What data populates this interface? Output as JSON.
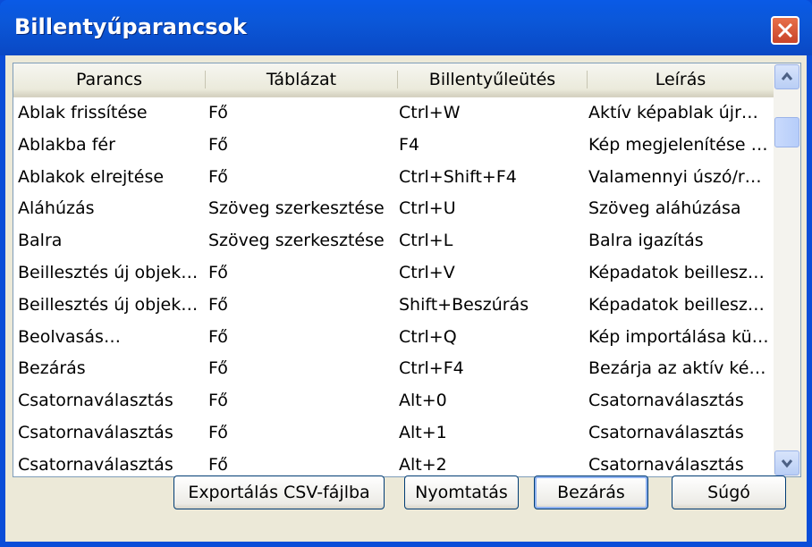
{
  "window": {
    "title": "Billentyűparancsok"
  },
  "columns": [
    "Parancs",
    "Táblázat",
    "Billentyűleütés",
    "Leírás"
  ],
  "rows": [
    [
      "Ablak frissítése",
      "Fő",
      "Ctrl+W",
      "Aktív képablak újr…"
    ],
    [
      "Ablakba fér",
      "Fő",
      "F4",
      "Kép megjelenítése …"
    ],
    [
      "Ablakok elrejtése",
      "Fő",
      "Ctrl+Shift+F4",
      "Valamennyi úszó/r…"
    ],
    [
      "Aláhúzás",
      "Szöveg szerkesztése",
      "Ctrl+U",
      "Szöveg aláhúzása"
    ],
    [
      "Balra",
      "Szöveg szerkesztése",
      "Ctrl+L",
      "Balra igazítás"
    ],
    [
      "Beillesztés új objek…",
      "Fő",
      "Ctrl+V",
      "Képadatok beillesz…"
    ],
    [
      "Beillesztés új objek…",
      "Fő",
      "Shift+Beszúrás",
      "Képadatok beillesz…"
    ],
    [
      "Beolvasás…",
      "Fő",
      "Ctrl+Q",
      "Kép importálása kü…"
    ],
    [
      "Bezárás",
      "Fő",
      "Ctrl+F4",
      "Bezárja az aktív ké…"
    ],
    [
      "Csatornaválasztás",
      "Fő",
      "Alt+0",
      "Csatornaválasztás"
    ],
    [
      "Csatornaválasztás",
      "Fő",
      "Alt+1",
      "Csatornaválasztás"
    ],
    [
      "Csatornaválasztás",
      "Fő",
      "Alt+2",
      "Csatornaválasztás"
    ]
  ],
  "buttons": {
    "export": "Exportálás CSV-fájlba",
    "print": "Nyomtatás",
    "close": "Bezárás",
    "help": "Súgó"
  },
  "icons": {
    "close": "close-icon",
    "scroll_up": "chevron-up-icon",
    "scroll_down": "chevron-down-icon"
  }
}
